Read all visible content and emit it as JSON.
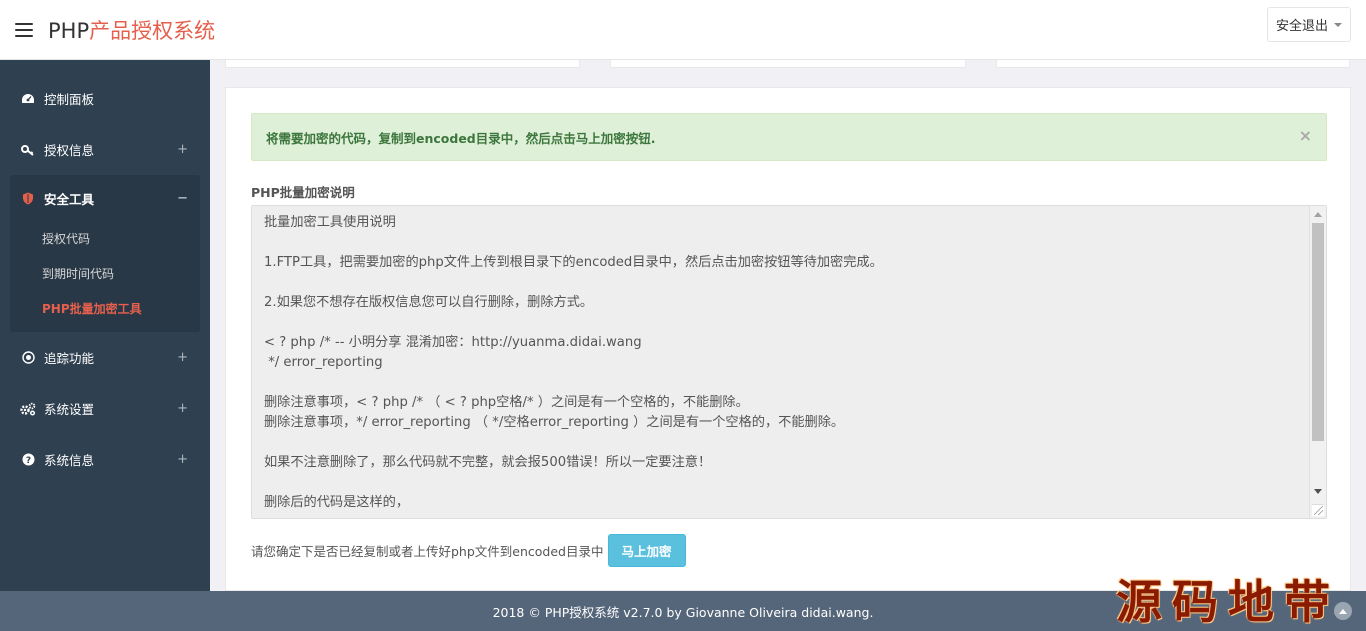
{
  "header": {
    "brand_prefix": "PHP",
    "brand_suffix": "产品授权系统",
    "logout_label": "安全退出"
  },
  "sidebar": {
    "items": [
      {
        "label": "控制面板",
        "icon": "dashboard-icon"
      },
      {
        "label": "授权信息",
        "icon": "key-icon",
        "toggle": "+"
      },
      {
        "label": "安全工具",
        "icon": "shield-icon",
        "toggle": "−"
      },
      {
        "label": "追踪功能",
        "icon": "target-icon",
        "toggle": "+"
      },
      {
        "label": "系统设置",
        "icon": "gears-icon",
        "toggle": "+"
      },
      {
        "label": "系统信息",
        "icon": "question-circle-icon",
        "toggle": "+"
      }
    ],
    "security_sub": [
      {
        "label": "授权代码"
      },
      {
        "label": "到期时间代码"
      },
      {
        "label": "PHP批量加密工具"
      }
    ],
    "active_color": "#e5604c"
  },
  "main": {
    "alert_text": "将需要加密的代码，复制到encoded目录中，然后点击马上加密按钮.",
    "alert_close": "×",
    "field_label": "PHP批量加密说明",
    "textarea_text": "批量加密工具使用说明\n\n1.FTP工具，把需要加密的php文件上传到根目录下的encoded目录中，然后点击加密按钮等待加密完成。\n\n2.如果您不想存在版权信息您可以自行删除，删除方式。\n\n< ? php /* -- 小明分享 混淆加密：http://yuanma.didai.wang\n */ error_reporting\n\n删除注意事项，< ? php /* （ < ? php空格/* ）之间是有一个空格的，不能删除。\n删除注意事项，*/ error_reporting （ */空格error_reporting ）之间是有一个空格的，不能删除。\n\n如果不注意删除了，那么代码就不完整，就会报500错误！所以一定要注意！\n\n删除后的代码是这样的，",
    "confirm_text": "请您确定下是否已经复制或者上传好php文件到encoded目录中",
    "encrypt_button": "马上加密"
  },
  "footer": {
    "text": "2018 © PHP授权系统 v2.7.0 by Giovanne Oliveira didai.wang."
  },
  "watermark": "源码地带",
  "colors": {
    "sidebar_bg": "#2f4050",
    "alert_bg": "#dff0d8",
    "button_bg": "#5bc0de",
    "footer_bg": "#56667a"
  }
}
